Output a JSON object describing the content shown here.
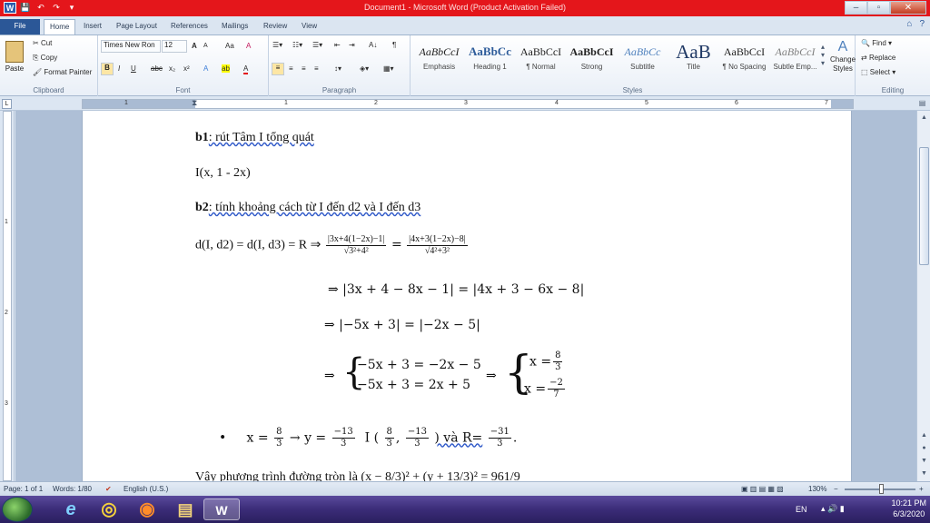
{
  "window": {
    "title": "Document1 - Microsoft Word (Product Activation Failed)",
    "minimize": "–",
    "maximize": "▫",
    "close": "✕"
  },
  "quick_access": {
    "word_logo": "W",
    "save": "💾",
    "undo": "↶",
    "redo": "↷",
    "customize": "▾"
  },
  "tabs": [
    {
      "label": "File"
    },
    {
      "label": "Home"
    },
    {
      "label": "Insert"
    },
    {
      "label": "Page Layout"
    },
    {
      "label": "References"
    },
    {
      "label": "Mailings"
    },
    {
      "label": "Review"
    },
    {
      "label": "View"
    }
  ],
  "tabs_right": {
    "minimize_ribbon": "⌂",
    "help": "?"
  },
  "ribbon": {
    "clipboard": {
      "paste": "Paste",
      "cut": "Cut",
      "copy": "Copy",
      "format_painter": "Format Painter",
      "label": "Clipboard"
    },
    "font": {
      "family": "Times New Ron",
      "size": "12",
      "grow": "A",
      "shrink": "A",
      "change_case": "Aa",
      "clear": "A",
      "bold": "B",
      "italic": "I",
      "underline": "U",
      "strikethrough": "abc",
      "subscript": "x₂",
      "superscript": "x²",
      "text_effects": "A",
      "highlight": "ab",
      "font_color": "A",
      "label": "Font"
    },
    "paragraph": {
      "label": "Paragraph",
      "sort": "A↓",
      "pilcrow": "¶"
    },
    "styles": {
      "items": [
        {
          "preview": "AaBbCcI",
          "name": "Emphasis"
        },
        {
          "preview": "AaBbCc",
          "name": "Heading 1"
        },
        {
          "preview": "AaBbCcI",
          "name": "¶ Normal"
        },
        {
          "preview": "AaBbCcI",
          "name": "Strong"
        },
        {
          "preview": "AaBbCc",
          "name": "Subtitle"
        },
        {
          "preview": "AaB",
          "name": "Title"
        },
        {
          "preview": "AaBbCcI",
          "name": "¶ No Spacing"
        },
        {
          "preview": "AaBbCcI",
          "name": "Subtle Emp..."
        }
      ],
      "change_styles": "Change Styles",
      "label": "Styles"
    },
    "editing": {
      "find": "Find",
      "replace": "Replace",
      "select": "Select",
      "label": "Editing"
    }
  },
  "ruler": {
    "numbers": [
      "1",
      "1",
      "2",
      "3",
      "4",
      "5",
      "6",
      "7"
    ],
    "vertical_numbers": [
      "1",
      "2",
      "3"
    ]
  },
  "document": {
    "l1_b": "b1",
    "l1_rest": ": rút Tâm I tổng quát",
    "l2": "I(x, 1 - 2x)",
    "l3_b": "b2",
    "l3_rest": ": tính khoảng cách từ I đến d2 và I đến d3",
    "l4_lhs": "d(I, d2) = d(I, d3) = R ⇒",
    "l4_f1_num": "|3x+4(1−2x)−1|",
    "l4_f1_den": "√3²+4²",
    "l4_eq": "=",
    "l4_f2_num": "|4x+3(1−2x)−8|",
    "l4_f2_den": "√4²+3²",
    "l5": "⇒ |3x + 4 − 8x − 1| = |4x + 3 − 6x − 8|",
    "l6": "⇒ |−5x + 3| = |−2x − 5|",
    "l7_arrow": "⇒",
    "l7_sys1": "−5x + 3 = −2x − 5",
    "l7_sys2": "−5x + 3 = 2x + 5",
    "l7_arrow2": "⇒",
    "l7_x1": "x =",
    "l7_x1_num": "8",
    "l7_x1_den": "3",
    "l7_x2": "x =",
    "l7_x2_num": "−2",
    "l7_x2_den": "7",
    "l8_bullet": "•",
    "l8_a": "x =",
    "l8_f1_num": "8",
    "l8_f1_den": "3",
    "l8_b": "→ y =",
    "l8_f2_num": "−13",
    "l8_f2_den": "3",
    "l8_c": "I (",
    "l8_f3_num": "8",
    "l8_f3_den": "3",
    "l8_sep": ",",
    "l8_f4_num": "−13",
    "l8_f4_den": "3",
    "l8_d": ") và R=",
    "l8_f5_num": "−31",
    "l8_f5_den": "3",
    "l8_end": ".",
    "l9_partial": "Vậy phương trình đường tròn là (x − 8/3)² + (y + 13/3)² = 961/9"
  },
  "status": {
    "page": "Page: 1 of 1",
    "words": "Words: 1/80",
    "language": "English (U.S.)",
    "zoom": "130%",
    "zoom_out": "−",
    "zoom_in": "+"
  },
  "taskbar": {
    "lang": "EN",
    "time": "10:21 PM",
    "date": "6/3/2020",
    "ie": "e",
    "chrome": "◎",
    "firefox": "◉",
    "explorer": "▤",
    "word": "W"
  },
  "colors": {
    "titlebar": "#e4161b",
    "file_tab": "#2b5797",
    "taskbar": "#3b2c78"
  }
}
